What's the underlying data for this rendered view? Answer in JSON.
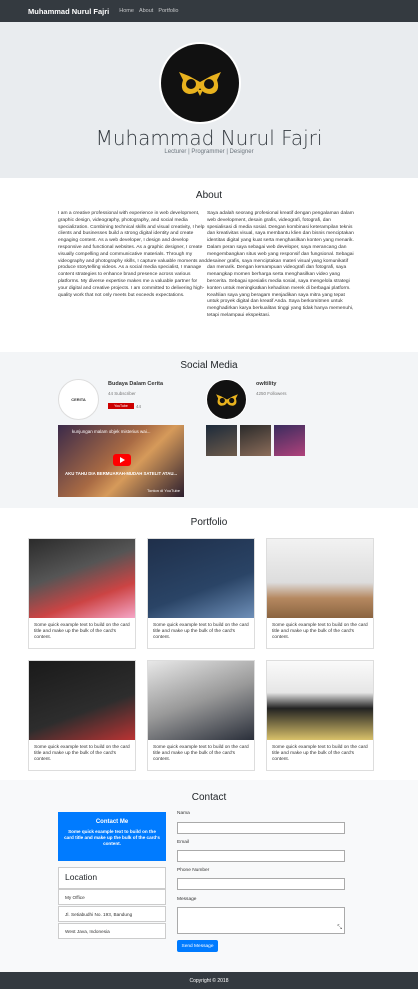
{
  "nav": {
    "brand": "Muhammad Nurul Fajri",
    "links": [
      "Home",
      "About",
      "Portfolio"
    ]
  },
  "hero": {
    "name": "Muhammad Nurul Fajri",
    "subtitle": "Lecturer | Programmer | Designer"
  },
  "about": {
    "title": "About",
    "en": "I am a creative professional with experience in web development, graphic design, videography, photography, and social media specialization. Combining technical skills and visual creativity, I help clients and businesses build a strong digital identity and create engaging content. As a web developer, I design and develop responsive and functional websites. As a graphic designer, I create visually compelling and communicative materials. Through my videography and photography skills, I capture valuable moments and produce storytelling videos. As a social media specialist, I manage content strategies to enhance brand presence across various platforms. My diverse expertise makes me a valuable partner for your digital and creative projects. I am committed to delivering high-quality work that not only meets but exceeds expectations.",
    "id": "Saya adalah seorang profesional kreatif dengan pengalaman dalam web development, desain grafis, videografi, fotografi, dan spesialisasi di media sosial. Dengan kombinasi keterampilan teknis dan kreativitas visual, saya membantu klien dan bisnis menciptakan identitas digital yang kuat serta menghasilkan konten yang menarik. Dalam peran saya sebagai web developer, saya merancang dan mengembangkan situs web yang responsif dan fungsional. Sebagai desainer grafis, saya menciptakan materi visual yang komunikatif dan menarik. Dengan kemampuan videografi dan fotografi, saya menangkap momen berharga serta menghasilkan video yang bercerita. Sebagai spesialis media sosial, saya mengelola strategi konten untuk meningkatkan kehadiran merek di berbagai platform. Keahlian saya yang beragam menjadikan saya mitra yang tepat untuk proyek digital dan kreatif Anda. Saya berkomitmen untuk menghadirkan karya berkualitas tinggi yang tidak hanya memenuhi, tetapi melampaui ekspektasi."
  },
  "social": {
    "title": "Social Media",
    "youtube": {
      "name": "Budaya Dalam Cerita",
      "subs": "44 Subscriber",
      "btn": "YouTube",
      "count": "44",
      "logo_text": "CERITA",
      "video_title": "kunjungan malam objek misterius wai...",
      "video_caption": "AKU TAHU DIA BERMUARAH-MUDAH SATELIT ATAU...",
      "video_footer": "Tonton di YouTube"
    },
    "instagram": {
      "name": "owltility",
      "followers": "4250 Followers"
    }
  },
  "portfolio": {
    "title": "Portfolio",
    "card_text": "Some quick example text to build on the card title and make up the bulk of the card's content."
  },
  "contact": {
    "title": "Contact",
    "box_title": "Contact Me",
    "box_text": "Some quick example text to build on the card title and make up the bulk of the card's content.",
    "location_title": "Location",
    "locations": [
      "My Office",
      "Jl. Setiabudhi No. 193, Bandung",
      "West Java, Indonesia"
    ],
    "labels": [
      "Nama",
      "Email",
      "Phone Number",
      "Message"
    ],
    "send": "Send Message"
  },
  "footer": {
    "copyright": "Copyright © 2018"
  },
  "colors": {
    "accent": "#007bff",
    "dark": "#343a40",
    "owl_gold": "#e8b21e"
  }
}
